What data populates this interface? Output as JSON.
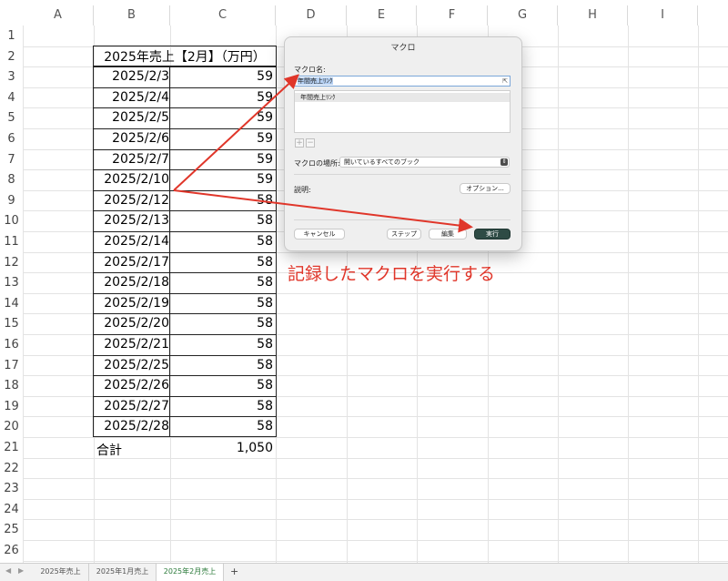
{
  "columns": [
    "A",
    "B",
    "C",
    "D",
    "E",
    "F",
    "G",
    "H",
    "I"
  ],
  "rows": [
    "1",
    "2",
    "3",
    "4",
    "5",
    "6",
    "7",
    "8",
    "9",
    "10",
    "11",
    "12",
    "13",
    "14",
    "15",
    "16",
    "17",
    "18",
    "19",
    "20",
    "21",
    "22",
    "23",
    "24",
    "25",
    "26"
  ],
  "table": {
    "header": "2025年売上【2月】（万円）",
    "data": [
      {
        "date": "2025/2/3",
        "value": "59"
      },
      {
        "date": "2025/2/4",
        "value": "59"
      },
      {
        "date": "2025/2/5",
        "value": "59"
      },
      {
        "date": "2025/2/6",
        "value": "59"
      },
      {
        "date": "2025/2/7",
        "value": "59"
      },
      {
        "date": "2025/2/10",
        "value": "59"
      },
      {
        "date": "2025/2/12",
        "value": "58"
      },
      {
        "date": "2025/2/13",
        "value": "58"
      },
      {
        "date": "2025/2/14",
        "value": "58"
      },
      {
        "date": "2025/2/17",
        "value": "58"
      },
      {
        "date": "2025/2/18",
        "value": "58"
      },
      {
        "date": "2025/2/19",
        "value": "58"
      },
      {
        "date": "2025/2/20",
        "value": "58"
      },
      {
        "date": "2025/2/21",
        "value": "58"
      },
      {
        "date": "2025/2/25",
        "value": "58"
      },
      {
        "date": "2025/2/26",
        "value": "58"
      },
      {
        "date": "2025/2/27",
        "value": "58"
      },
      {
        "date": "2025/2/28",
        "value": "58"
      }
    ],
    "total_label": "合計",
    "total_value": "1,050"
  },
  "dialog": {
    "title": "マクロ",
    "macro_name_label": "マクロ名:",
    "macro_name_value": "年間売上ﾘﾝｸ",
    "list_items": [
      "年間売上ﾘﾝｸ"
    ],
    "plus": "+",
    "minus": "−",
    "location_label": "マクロの場所:",
    "location_value": "開いているすべてのブック",
    "description_label": "説明:",
    "options_button": "オプション...",
    "cancel_button": "キャンセル",
    "step_button": "ステップ",
    "edit_button": "編集",
    "run_button": "実行"
  },
  "annotation": "記録したマクロを実行する",
  "annotation_color": "#e0362a",
  "sheet_tabs": {
    "nav_prev": "◀",
    "nav_next": "▶",
    "tabs": [
      "2025年売上",
      "2025年1月売上",
      "2025年2月売上"
    ],
    "active_index": 2,
    "add": "+"
  },
  "colors": {
    "active_tab_text": "#2b7a3a",
    "run_button": "#2e4b45",
    "grid": "#e3e3e3"
  }
}
